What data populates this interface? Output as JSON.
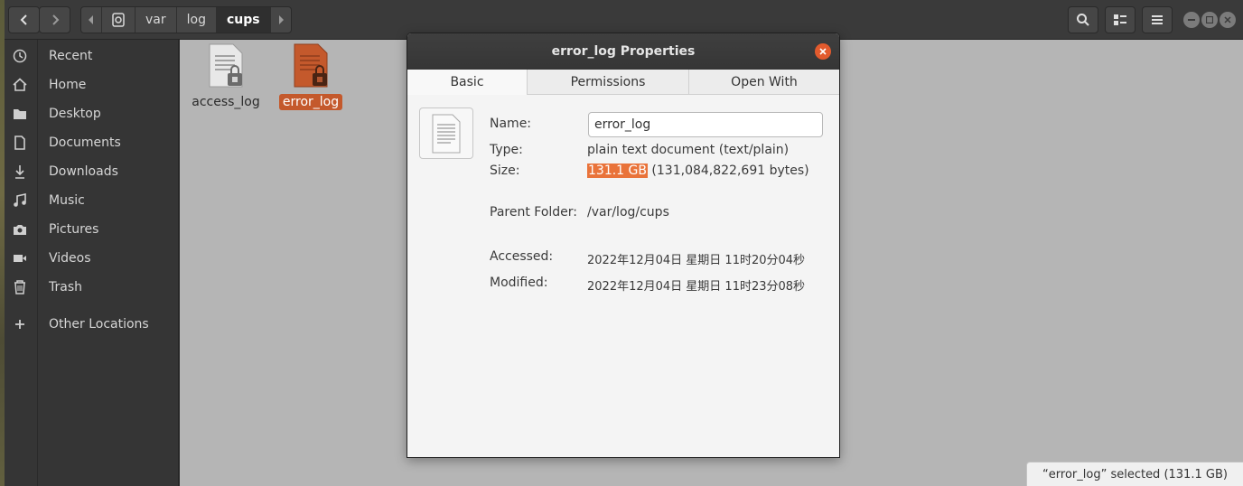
{
  "header": {
    "path": [
      "var",
      "log",
      "cups"
    ],
    "active_path": "cups"
  },
  "sidebar": {
    "items": [
      {
        "label": "Recent",
        "icon": "clock-icon"
      },
      {
        "label": "Home",
        "icon": "home-icon"
      },
      {
        "label": "Desktop",
        "icon": "folder-icon"
      },
      {
        "label": "Documents",
        "icon": "document-icon"
      },
      {
        "label": "Downloads",
        "icon": "download-icon"
      },
      {
        "label": "Music",
        "icon": "music-icon"
      },
      {
        "label": "Pictures",
        "icon": "camera-icon"
      },
      {
        "label": "Videos",
        "icon": "video-icon"
      },
      {
        "label": "Trash",
        "icon": "trash-icon"
      },
      {
        "label": "Other Locations",
        "icon": "plus-icon"
      }
    ]
  },
  "files": [
    {
      "name": "access_log",
      "selected": false
    },
    {
      "name": "error_log",
      "selected": true
    }
  ],
  "statusbar": {
    "text": "“error_log” selected  (131.1 GB)"
  },
  "dialog": {
    "title": "error_log Properties",
    "tabs": [
      "Basic",
      "Permissions",
      "Open With"
    ],
    "active_tab": "Basic",
    "fields": {
      "name_label": "Name:",
      "name_value": "error_log",
      "type_label": "Type:",
      "type_value": "plain text document (text/plain)",
      "size_label": "Size:",
      "size_highlight": "131.1 GB",
      "size_rest": " (131,084,822,691 bytes)",
      "parent_label": "Parent Folder:",
      "parent_value": "/var/log/cups",
      "accessed_label": "Accessed:",
      "accessed_value": "2022年12月04日 星期日 11时20分04秒",
      "modified_label": "Modified:",
      "modified_value": "2022年12月04日 星期日 11时23分08秒"
    }
  },
  "colors": {
    "accent": "#e9733a",
    "selection": "#c4592c",
    "close": "#e25a2d"
  }
}
